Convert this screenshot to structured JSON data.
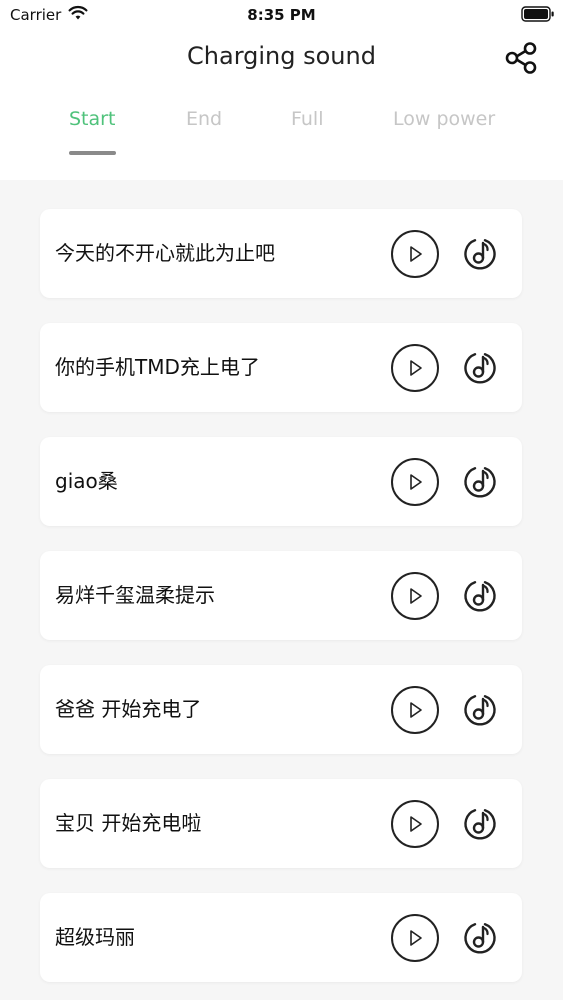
{
  "status_bar": {
    "carrier": "Carrier",
    "time": "8:35 PM",
    "wifi_icon": "wifi-icon",
    "battery_icon": "battery-icon"
  },
  "header": {
    "title": "Charging sound",
    "share_icon": "share-icon"
  },
  "tabs": [
    {
      "label": "Start",
      "active": true
    },
    {
      "label": "End",
      "active": false
    },
    {
      "label": "Full",
      "active": false
    },
    {
      "label": "Low power",
      "active": false
    }
  ],
  "colors": {
    "accent": "#4fc27b",
    "tab_inactive": "#c6c6c6",
    "background": "#f6f6f6",
    "card": "#ffffff"
  },
  "sounds": [
    {
      "title": "今天的不开心就此为止吧"
    },
    {
      "title": "你的手机TMD充上电了"
    },
    {
      "title": "giao桑"
    },
    {
      "title": "易烊千玺温柔提示"
    },
    {
      "title": "爸爸 开始充电了"
    },
    {
      "title": "宝贝 开始充电啦"
    },
    {
      "title": "超级玛丽"
    }
  ],
  "item_icons": {
    "play": "play-icon",
    "set_ringtone": "music-note-icon"
  }
}
